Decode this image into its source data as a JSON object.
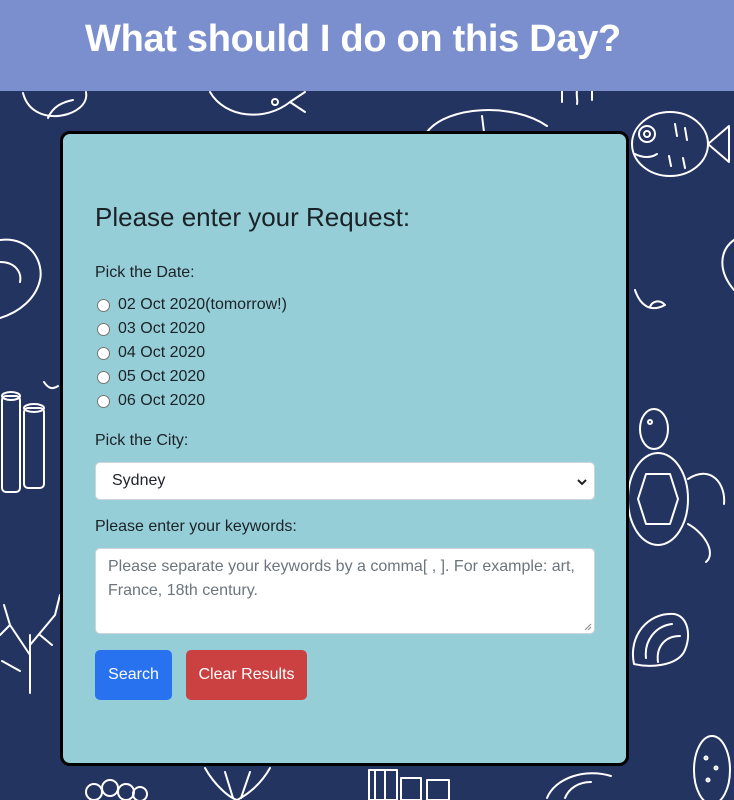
{
  "header": {
    "title": "What should I do on this Day?"
  },
  "form": {
    "heading": "Please enter your Request:",
    "date_label": "Pick the Date:",
    "dates": [
      "02 Oct 2020(tomorrow!)",
      "03 Oct 2020",
      "04 Oct 2020",
      "05 Oct 2020",
      "06 Oct 2020"
    ],
    "city_label": "Pick the City:",
    "city_selected": "Sydney",
    "keywords_label": "Please enter your keywords:",
    "keywords_placeholder": "Please separate your keywords by a comma[ , ]. For example: art, France, 18th century.",
    "search_label": "Search",
    "clear_label": "Clear Results"
  },
  "colors": {
    "background": "#243461",
    "header": "#7b8fcf",
    "card": "#96ced7",
    "search_button": "#2872f0",
    "clear_button": "#cb4142"
  }
}
